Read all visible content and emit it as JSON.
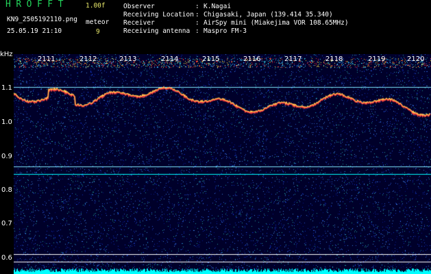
{
  "header": {
    "app_title": "HROFFT",
    "version": "1.00f",
    "file_name": "KN9_2505192110.png",
    "datetime": "25.05.19 21:10",
    "meteor_label": "meteor",
    "meteor_count": "9"
  },
  "info": [
    {
      "key": "Observer",
      "sep": ":",
      "value": "K.Nagai"
    },
    {
      "key": "Receiving Location",
      "sep": ":",
      "value": "Chigasaki, Japan (139.414 35.340)"
    },
    {
      "key": "Receiver",
      "sep": ":",
      "value": "AirSpy mini (Miakejima VOR 108.65MHz)"
    },
    {
      "key": "Receiving antenna",
      "sep": ":",
      "value": "Maspro FM-3"
    }
  ],
  "waterfall": {
    "y_unit": "kHz",
    "y_ticks": [
      "1.1",
      "1.0",
      "0.9",
      "0.8",
      "0.7",
      "0.6"
    ],
    "time_labels": [
      "2111",
      "2112",
      "2113",
      "2114",
      "2115",
      "2116",
      "2117",
      "2118",
      "2119",
      "2120"
    ],
    "colors": {
      "background": "#00002a",
      "signal": "#ff4040",
      "trace": "#ffee55",
      "band": "#00ffff"
    }
  }
}
